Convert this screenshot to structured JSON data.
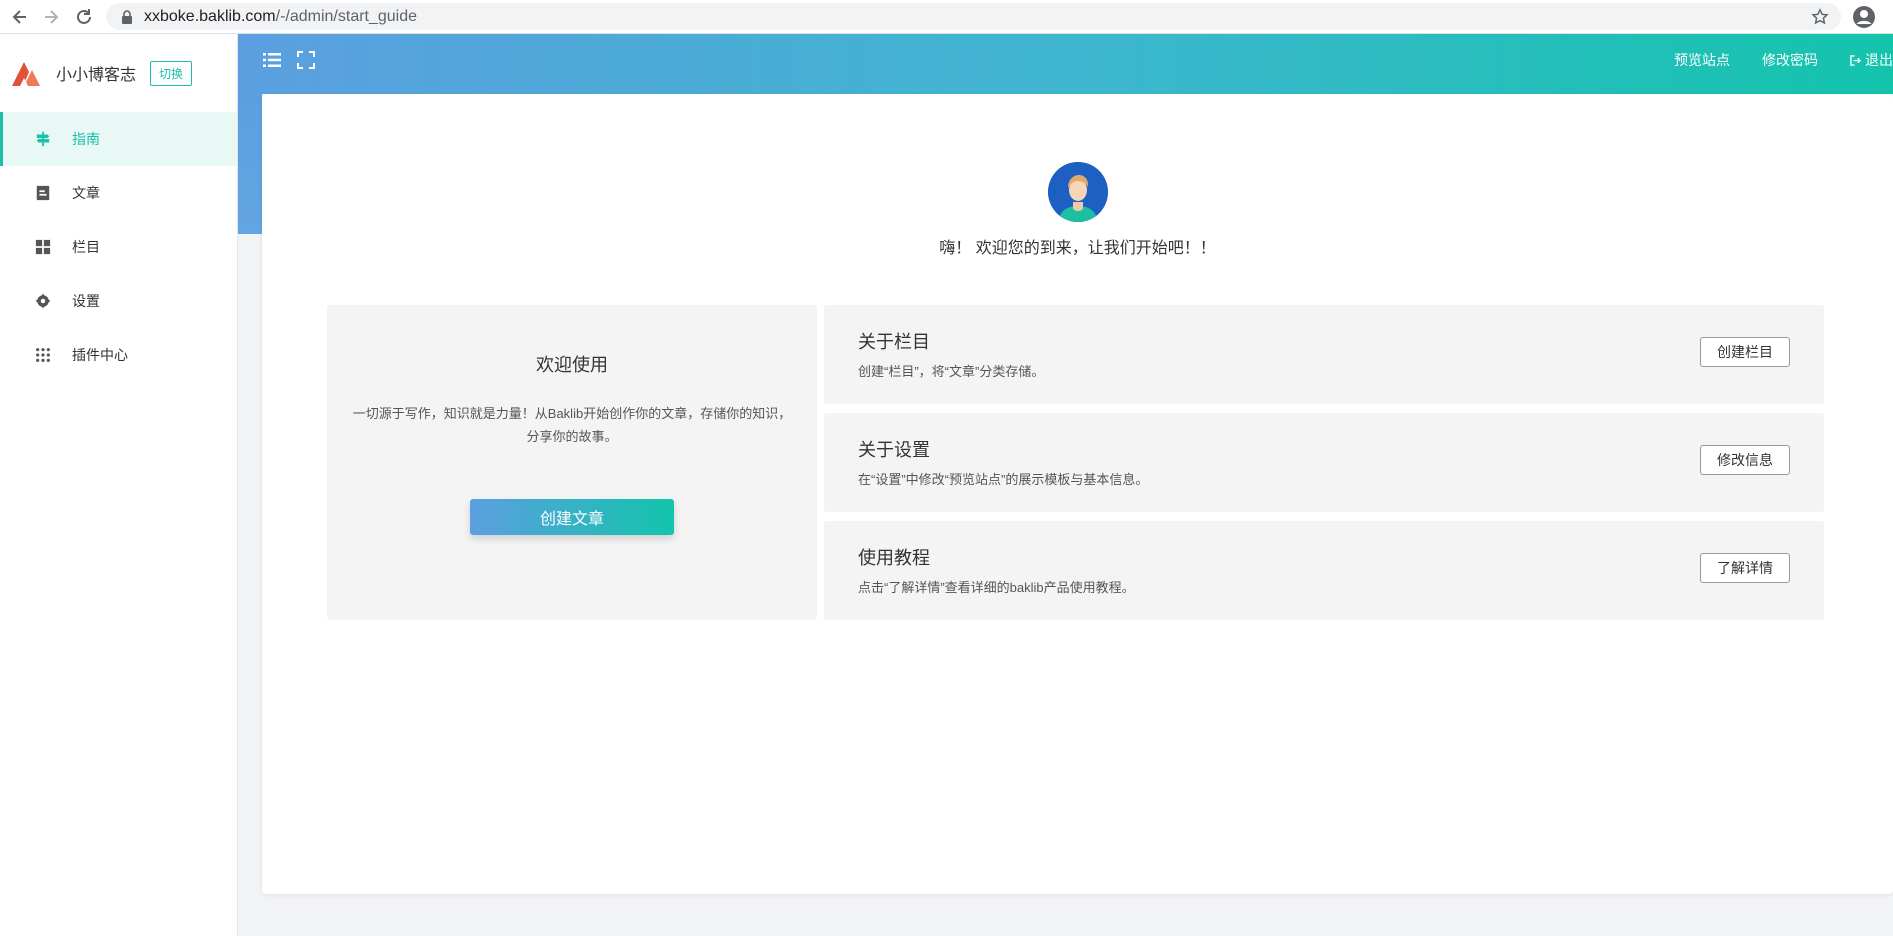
{
  "browser": {
    "url_host": "xxboke.baklib.com",
    "url_path": "/-/admin/start_guide"
  },
  "sidebar": {
    "brand_name": "小小博客志",
    "switch_label": "切换",
    "items": [
      {
        "label": "指南",
        "icon": "signpost-icon",
        "active": true
      },
      {
        "label": "文章",
        "icon": "document-icon",
        "active": false
      },
      {
        "label": "栏目",
        "icon": "grid-icon",
        "active": false
      },
      {
        "label": "设置",
        "icon": "gear-icon",
        "active": false
      },
      {
        "label": "插件中心",
        "icon": "apps-icon",
        "active": false
      }
    ]
  },
  "topbar": {
    "preview_site": "预览站点",
    "change_password": "修改密码",
    "logout": "退出"
  },
  "main": {
    "welcome_text": "嗨！ 欢迎您的到来，让我们开始吧！！",
    "intro": {
      "title": "欢迎使用",
      "description": "一切源于写作，知识就是力量！从Baklib开始创作你的文章，存储你的知识，分享你的故事。",
      "button": "创建文章"
    },
    "cards": [
      {
        "title": "关于栏目",
        "description": "创建“栏目”，将“文章”分类存储。",
        "button": "创建栏目"
      },
      {
        "title": "关于设置",
        "description": "在“设置”中修改“预览站点”的展示模板与基本信息。",
        "button": "修改信息"
      },
      {
        "title": "使用教程",
        "description": "点击“了解详情”查看详细的baklib产品使用教程。",
        "button": "了解详情"
      }
    ]
  },
  "colors": {
    "accent": "#1cbfa9",
    "gradient_start": "#5b9fe0",
    "gradient_end": "#13c4ac"
  }
}
